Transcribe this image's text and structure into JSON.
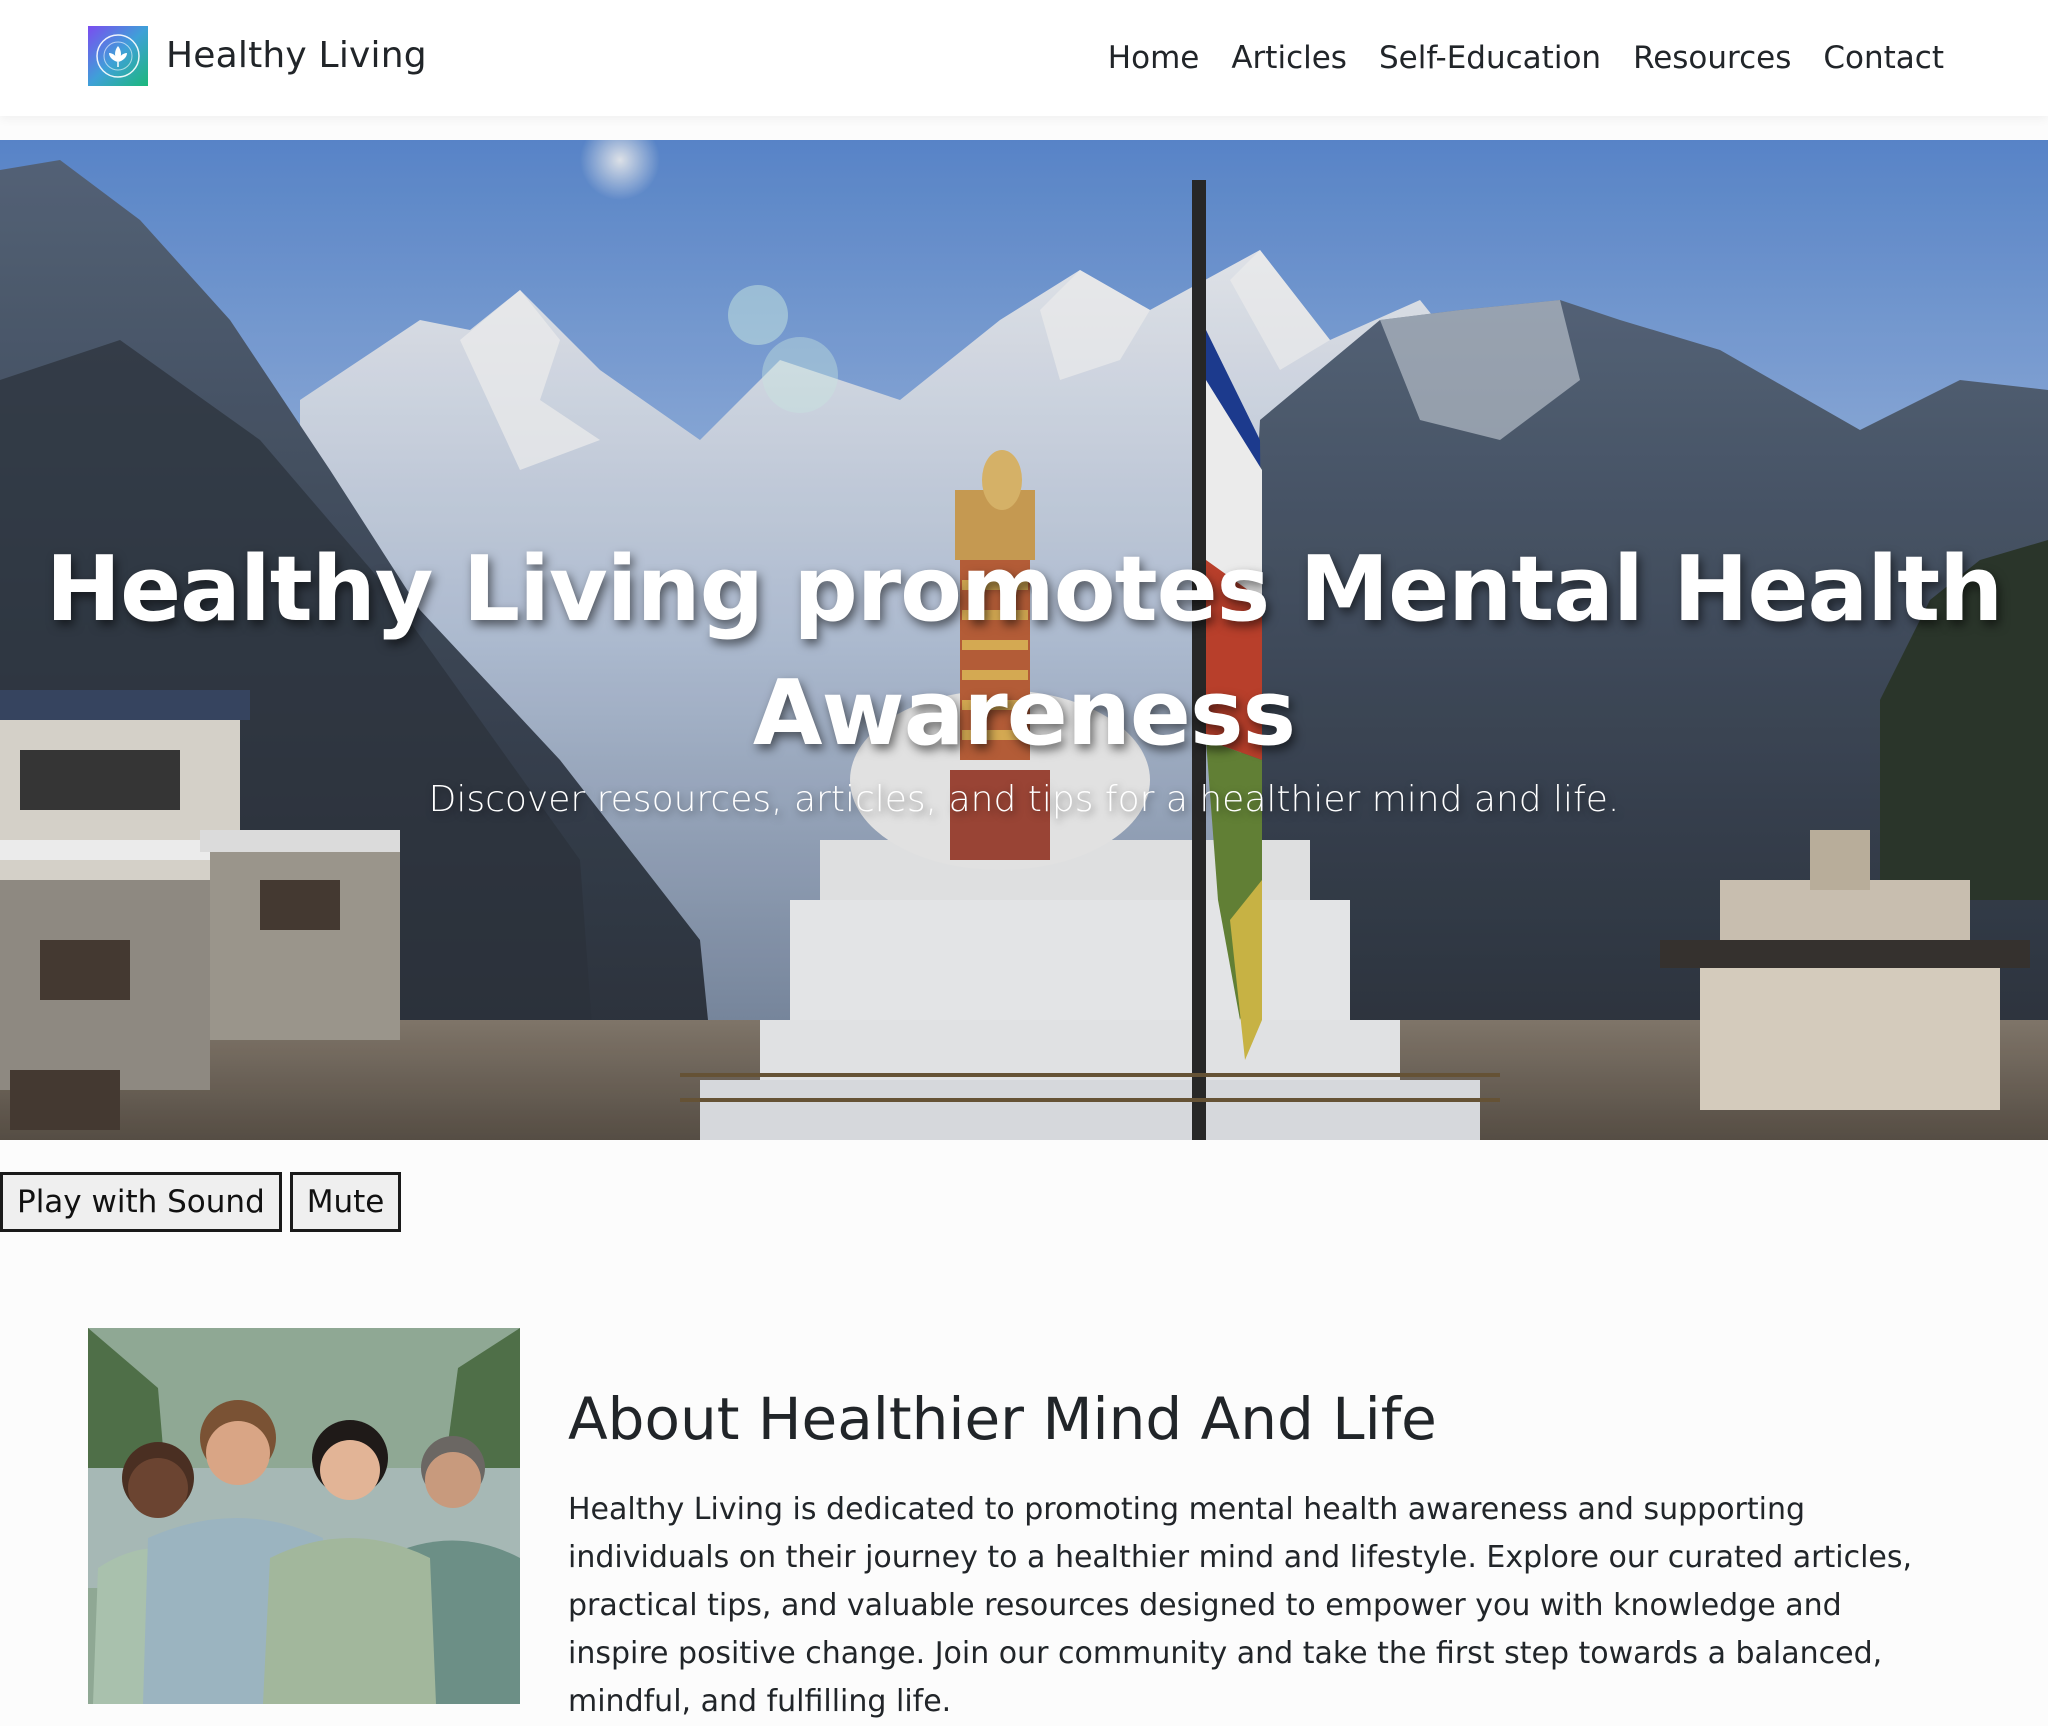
{
  "brand": {
    "name": "Healthy Living",
    "logo_icon": "lotus-leaf-logo",
    "logo_text": "HEALTHY LIVING"
  },
  "nav": {
    "items": [
      {
        "label": "Home"
      },
      {
        "label": "Articles"
      },
      {
        "label": "Self-Education"
      },
      {
        "label": "Resources"
      },
      {
        "label": "Contact"
      }
    ]
  },
  "hero": {
    "title": "Healthy Living promotes Mental Health Awareness",
    "subtitle": "Discover resources, articles, and tips for a healthier mind and life.",
    "media": "video-background-himalayan-stupa"
  },
  "video_controls": {
    "play_label": "Play with Sound",
    "mute_label": "Mute"
  },
  "about": {
    "title": "About Healthier Mind And Life",
    "text": "Healthy Living is dedicated to promoting mental health awareness and supporting individuals on their journey to a healthier mind and lifestyle. Explore our curated articles, practical tips, and valuable resources designed to empower you with knowledge and inspire positive change. Join our community and take the first step towards a balanced, mindful, and fulfilling life.",
    "image": "group-portrait-four-people-by-lake"
  },
  "colors": {
    "text": "#212529",
    "navbar_bg": "#ffffff",
    "page_bg": "#fcfcfc",
    "logo_gradient_start": "#7b4cf0",
    "logo_gradient_end": "#1bb87a"
  }
}
